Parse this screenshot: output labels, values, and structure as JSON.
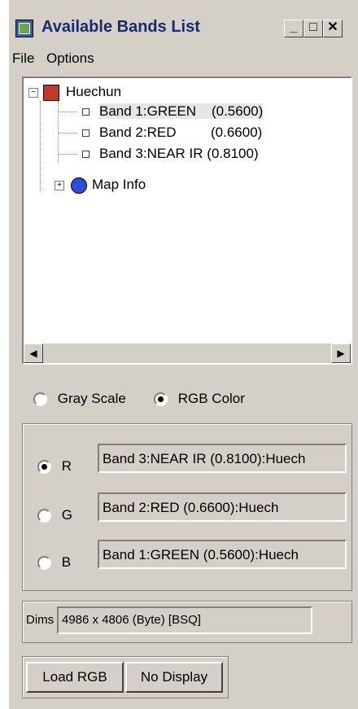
{
  "window": {
    "title": "Available Bands List",
    "min_label": "_",
    "max_label": "□",
    "close_label": "✕"
  },
  "menu": [
    "File",
    "Options"
  ],
  "tree": {
    "root": "Huechun",
    "bands": [
      {
        "name": "Band 1:GREEN",
        "wavelength": "(0.5600)"
      },
      {
        "name": "Band 2:RED",
        "wavelength": "(0.6600)"
      },
      {
        "name": "Band 3:NEAR IR",
        "wavelength": "(0.8100)"
      }
    ],
    "map_info": "Map Info"
  },
  "mode": {
    "gray_label": "Gray Scale",
    "rgb_label": "RGB Color",
    "selected": "RGB Color"
  },
  "rgb": {
    "r_label": "R",
    "g_label": "G",
    "b_label": "B",
    "r_value": "Band 3:NEAR IR  (0.8100):Huech",
    "g_value": "Band 2:RED        (0.6600):Huech",
    "b_value": "Band 1:GREEN    (0.5600):Huech",
    "selected": "R"
  },
  "dims": {
    "label": "Dims",
    "value": "4986 x 4806 (Byte) [BSQ]"
  },
  "buttons": {
    "load": "Load RGB",
    "display": "No Display"
  }
}
